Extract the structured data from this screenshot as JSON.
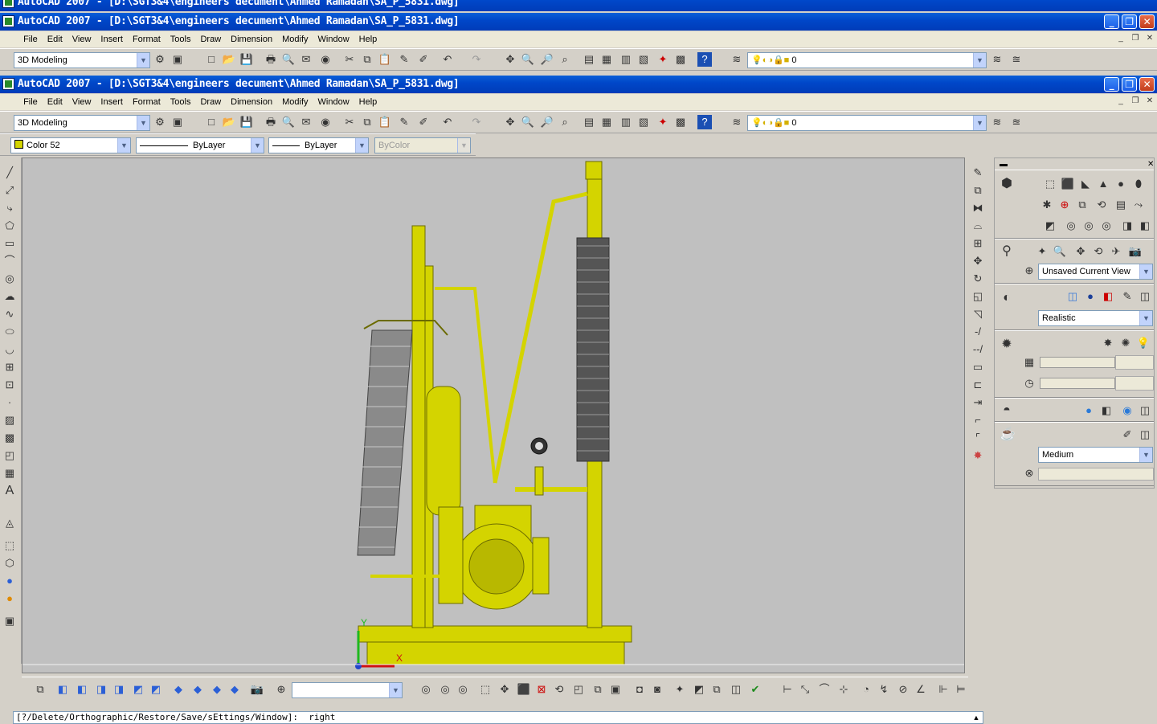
{
  "colors": {
    "model": "#d4d400",
    "viewport": "#c0c0c0",
    "title": "#0047c9"
  },
  "window_back": {
    "title": "AutoCAD 2007 - [D:\\SGT3&4\\engineers decument\\Ahmed Ramadan\\SA_P_5831.dwg]"
  },
  "window_front": {
    "title": "AutoCAD 2007 - [D:\\SGT3&4\\engineers decument\\Ahmed Ramadan\\SA_P_5831.dwg]"
  },
  "menu": [
    "File",
    "Edit",
    "View",
    "Insert",
    "Format",
    "Tools",
    "Draw",
    "Dimension",
    "Modify",
    "Window",
    "Help"
  ],
  "workspace": {
    "value": "3D Modeling"
  },
  "layer": {
    "value": "0"
  },
  "properties": {
    "color": "Color 52",
    "linetype": "ByLayer",
    "lineweight": "ByLayer",
    "plotstyle": "ByColor"
  },
  "dashboard": {
    "view": "Unsaved Current View",
    "visual_style": "Realistic",
    "quality": "Medium"
  },
  "command_line": "[?/Delete/Orthographic/Restore/Save/sEttings/Window]:  right",
  "icons": {
    "left": [
      "line-icon",
      "polyline-icon",
      "construction-line-icon",
      "polygon-icon",
      "rectangle-icon",
      "arc-icon",
      "circle-icon",
      "revision-cloud-icon",
      "spline-icon",
      "ellipse-icon",
      "ellipse-arc-icon",
      "insert-block-icon",
      "make-block-icon",
      "point-icon",
      "hatch-icon",
      "gradient-icon",
      "region-icon",
      "table-icon",
      "text-icon",
      "multiline-text-icon",
      "box-icon",
      "wedge-icon",
      "sphere-icon",
      "render-icon",
      "material-icon"
    ],
    "right": [
      "erase-icon",
      "copy-icon",
      "mirror-icon",
      "offset-icon",
      "array-icon",
      "move-icon",
      "rotate-icon",
      "scale-icon",
      "stretch-icon",
      "trim-icon",
      "extend-icon",
      "break-icon",
      "break-at-point-icon",
      "join-icon",
      "chamfer-icon",
      "fillet-icon",
      "explode-icon"
    ]
  }
}
